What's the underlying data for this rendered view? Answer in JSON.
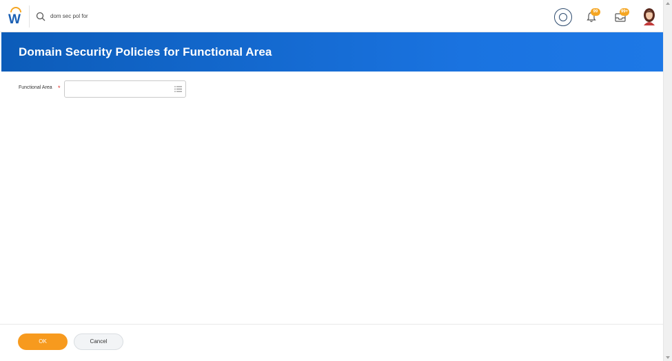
{
  "topbar": {
    "search_value": "dom sec pol for",
    "notifications_badge": "99",
    "inbox_badge": "99+"
  },
  "header": {
    "title": "Domain Security Policies for Functional Area",
    "band_color": "#0f63c4"
  },
  "form": {
    "functional_area_label": "Functional Area",
    "required_marker": "*",
    "functional_area_value": ""
  },
  "footer": {
    "ok_label": "OK",
    "cancel_label": "Cancel",
    "ok_color": "#f79a1e"
  },
  "icons": [
    "workday-logo-icon",
    "search-icon",
    "assistant-icon",
    "bell-icon",
    "inbox-icon",
    "avatar",
    "list-icon"
  ]
}
